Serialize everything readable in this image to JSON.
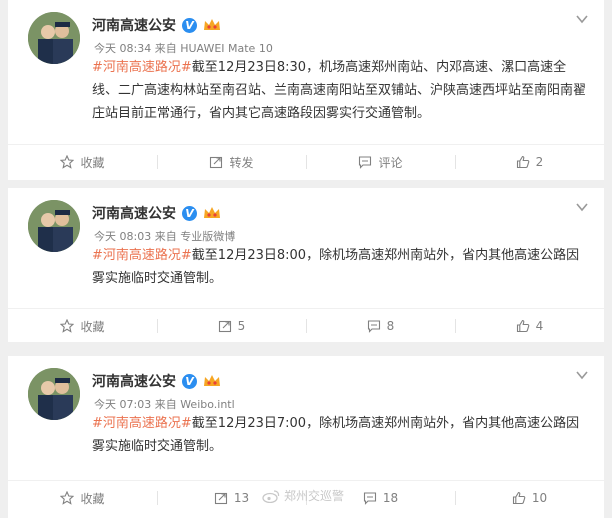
{
  "posts": [
    {
      "author": "河南高速公安",
      "time": "今天 08:34",
      "source_prefix": "来自",
      "source": "HUAWEI Mate 10",
      "hashtag": "#河南高速路况#",
      "text": "截至12月23日8:30，机场高速郑州南站、内邓高速、漯口高速全线、二广高速构林站至南召站、兰南高速南阳站至双铺站、沪陕高速西坪站至南阳南翟庄站目前正常通行，省内其它高速路段因雾实行交通管制。",
      "actions": {
        "collect": "收藏",
        "forward": "转发",
        "comment": "评论",
        "like": "2"
      }
    },
    {
      "author": "河南高速公安",
      "time": "今天 08:03",
      "source_prefix": "来自",
      "source": "专业版微博",
      "hashtag": "#河南高速路况#",
      "text": "截至12月23日8:00，除机场高速郑州南站外，省内其他高速公路因雾实施临时交通管制。",
      "actions": {
        "collect": "收藏",
        "forward": "5",
        "comment": "8",
        "like": "4"
      }
    },
    {
      "author": "河南高速公安",
      "time": "今天 07:03",
      "source_prefix": "来自",
      "source": "Weibo.intl",
      "hashtag": "#河南高速路况#",
      "text": "截至12月23日7:00，除机场高速郑州南站外，省内其他高速公路因雾实施临时交通管制。",
      "actions": {
        "collect": "收藏",
        "forward": "13",
        "comment": "18",
        "like": "10"
      }
    }
  ],
  "watermark": "郑州交巡警",
  "colors": {
    "hashtag": "#eb7350",
    "verified": "#2b8ef0",
    "background": "#efefef"
  }
}
